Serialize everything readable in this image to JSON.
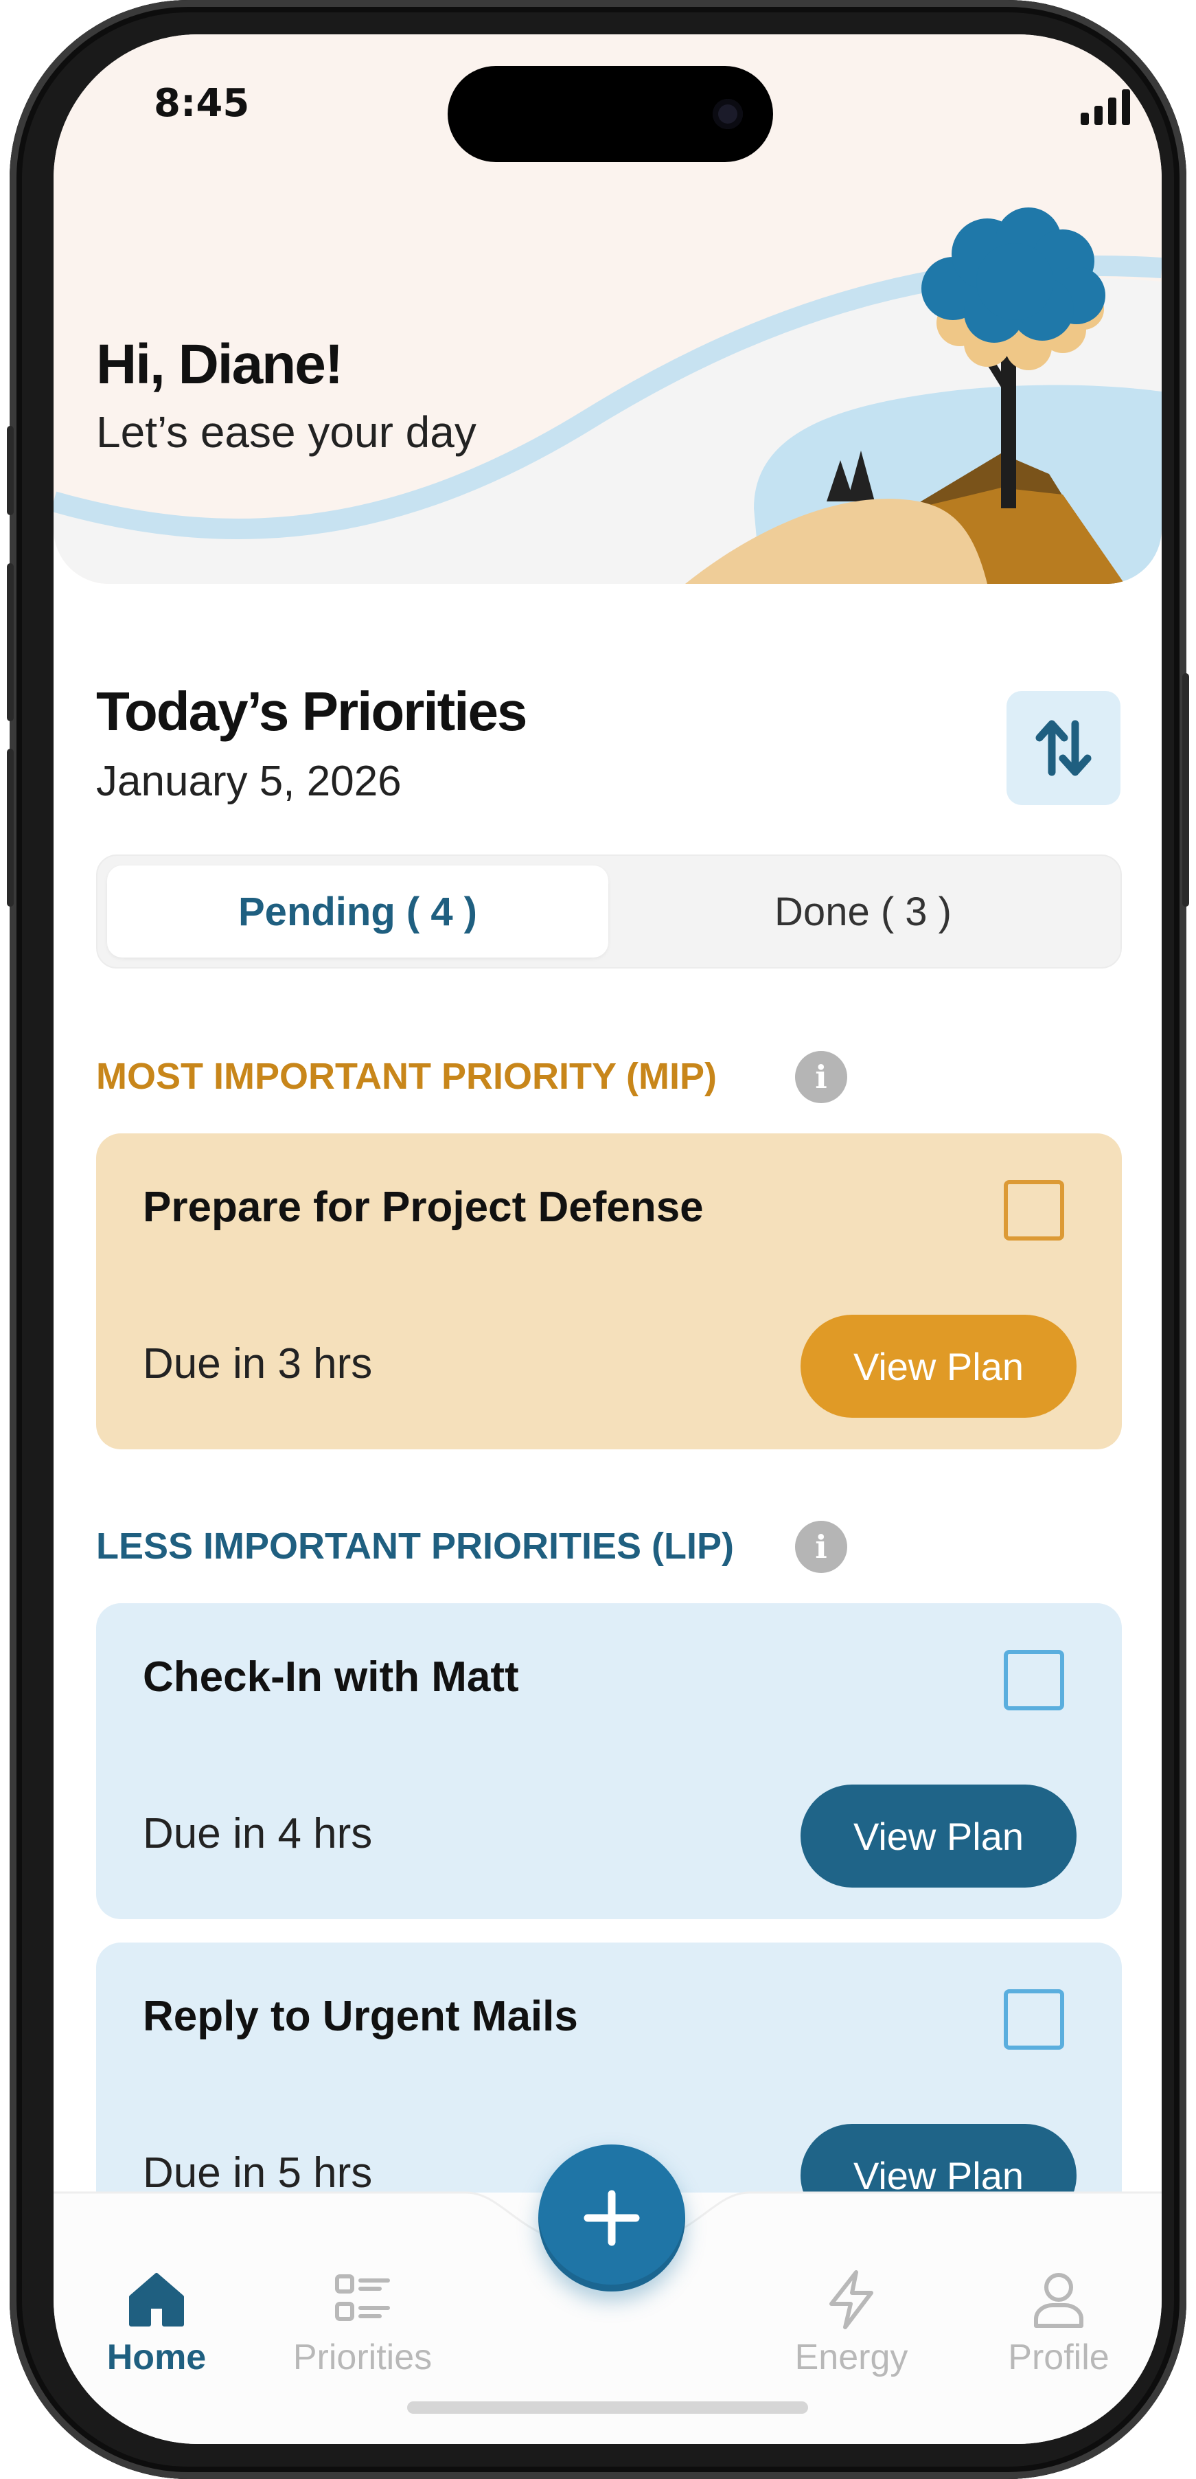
{
  "status_bar": {
    "time": "8:45"
  },
  "header": {
    "greeting": "Hi, Diane!",
    "subtitle": "Let’s ease your day"
  },
  "priorities": {
    "title": "Today’s Priorities",
    "date": "January 5, 2026",
    "sort_icon": "sort-arrows-icon",
    "tabs": [
      {
        "label": "Pending ( 4 )",
        "active": true
      },
      {
        "label": "Done ( 3 )",
        "active": false
      }
    ]
  },
  "mip": {
    "label": "MOST IMPORTANT PRIORITY (MIP)",
    "color": "#c8861a",
    "cards": [
      {
        "title": "Prepare for Project Defense",
        "due": "Due in 3 hrs",
        "button": "View Plan",
        "checked": false
      }
    ]
  },
  "lip": {
    "label": "LESS IMPORTANT PRIORITIES (LIP)",
    "color": "#1f5f80",
    "cards": [
      {
        "title": "Check-In with Matt",
        "due": "Due in 4 hrs",
        "button": "View Plan",
        "checked": false
      },
      {
        "title": "Reply to Urgent Mails",
        "due": "Due in 5 hrs",
        "button": "View Plan",
        "checked": false
      }
    ]
  },
  "nav": {
    "items": [
      {
        "label": "Home",
        "icon": "home-icon",
        "active": true
      },
      {
        "label": "Priorities",
        "icon": "list-icon",
        "active": false
      },
      {
        "label": "Energy",
        "icon": "lightning-icon",
        "active": false
      },
      {
        "label": "Profile",
        "icon": "profile-icon",
        "active": false
      }
    ],
    "fab_icon": "plus-icon"
  },
  "colors": {
    "accent": "#1f5f80",
    "mip_card": "#f5e0bb",
    "mip_button": "#e09a26",
    "lip_card": "#dfeef8",
    "lip_button": "#1f6488"
  }
}
